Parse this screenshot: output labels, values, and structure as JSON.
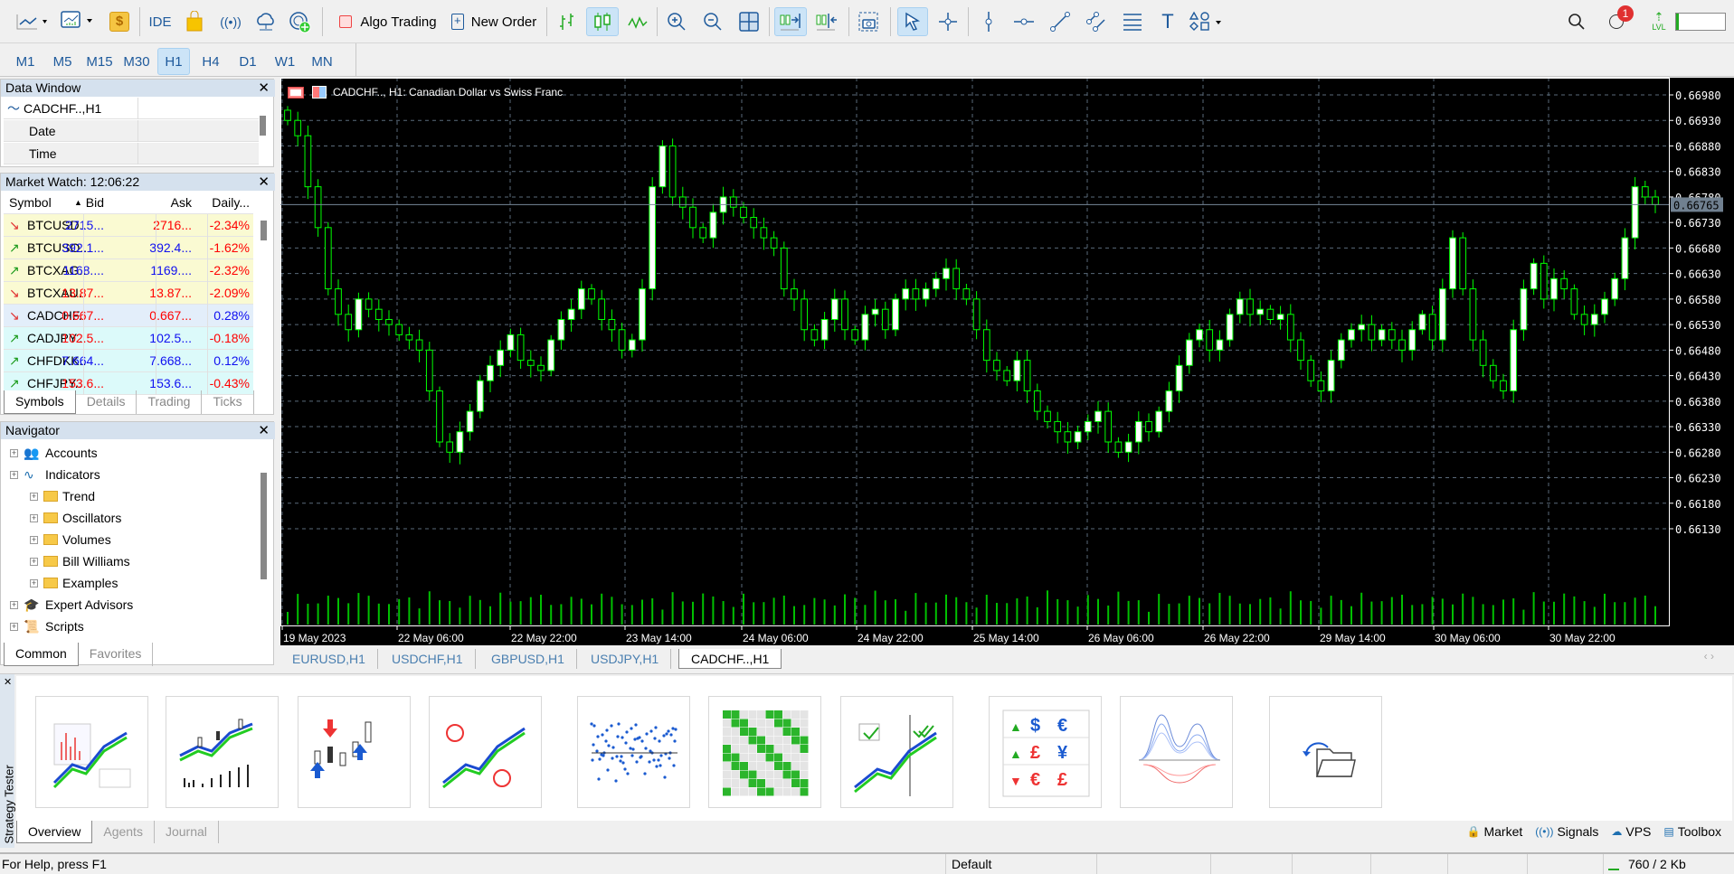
{
  "toolbar": {
    "ide": "IDE",
    "algo_trading": "Algo Trading",
    "new_order": "New Order",
    "notification_count": "1",
    "level_label": "LVL"
  },
  "timeframes": [
    {
      "label": "M1"
    },
    {
      "label": "M5"
    },
    {
      "label": "M15"
    },
    {
      "label": "M30"
    },
    {
      "label": "H1",
      "active": true
    },
    {
      "label": "H4"
    },
    {
      "label": "D1"
    },
    {
      "label": "W1"
    },
    {
      "label": "MN"
    }
  ],
  "data_window": {
    "title": "Data Window",
    "symbol": "CADCHF..,H1",
    "rows": [
      {
        "label": "Date"
      },
      {
        "label": "Time"
      }
    ]
  },
  "market_watch": {
    "title": "Market Watch: 12:06:22",
    "columns": [
      "Symbol",
      "Bid",
      "Ask",
      "Daily..."
    ],
    "rows": [
      {
        "dir": "down",
        "symbol": "BTCUSD..",
        "bid": "2715...",
        "ask": "2716...",
        "daily": "-2.34%",
        "bid_c": "blue",
        "ask_c": "red",
        "daily_c": "red",
        "bg": "#fafad2"
      },
      {
        "dir": "up",
        "symbol": "BTCUSO..",
        "bid": "392.1...",
        "ask": "392.4...",
        "daily": "-1.62%",
        "bid_c": "blue",
        "ask_c": "blue",
        "daily_c": "red",
        "bg": "#fafad2"
      },
      {
        "dir": "up",
        "symbol": "BTCXAG..",
        "bid": "1168....",
        "ask": "1169....",
        "daily": "-2.32%",
        "bid_c": "blue",
        "ask_c": "blue",
        "daily_c": "red",
        "bg": "#fafad2"
      },
      {
        "dir": "down",
        "symbol": "BTCXAU..",
        "bid": "13.87...",
        "ask": "13.87...",
        "daily": "-2.09%",
        "bid_c": "red",
        "ask_c": "red",
        "daily_c": "red",
        "bg": "#fafad2"
      },
      {
        "dir": "down",
        "symbol": "CADCHF..",
        "bid": "0.667...",
        "ask": "0.667...",
        "daily": "0.28%",
        "bid_c": "red",
        "ask_c": "red",
        "daily_c": "blue",
        "bg": "#e3eefa"
      },
      {
        "dir": "up",
        "symbol": "CADJPY..",
        "bid": "102.5...",
        "ask": "102.5...",
        "daily": "-0.18%",
        "bid_c": "red",
        "ask_c": "blue",
        "daily_c": "red",
        "bg": "#dcfafa"
      },
      {
        "dir": "up",
        "symbol": "CHFDKK..",
        "bid": "7.664...",
        "ask": "7.668...",
        "daily": "0.12%",
        "bid_c": "blue",
        "ask_c": "blue",
        "daily_c": "blue",
        "bg": "#dcfafa"
      },
      {
        "dir": "up",
        "symbol": "CHFJPY..",
        "bid": "153.6...",
        "ask": "153.6...",
        "daily": "-0.43%",
        "bid_c": "red",
        "ask_c": "blue",
        "daily_c": "red",
        "bg": "#dcfafa"
      }
    ],
    "tabs": [
      "Symbols",
      "Details",
      "Trading",
      "Ticks"
    ]
  },
  "navigator": {
    "title": "Navigator",
    "items": [
      {
        "label": "Accounts",
        "level": 0,
        "icon": "accounts"
      },
      {
        "label": "Indicators",
        "level": 0,
        "icon": "indicators"
      },
      {
        "label": "Trend",
        "level": 1,
        "icon": "folder"
      },
      {
        "label": "Oscillators",
        "level": 1,
        "icon": "folder"
      },
      {
        "label": "Volumes",
        "level": 1,
        "icon": "folder"
      },
      {
        "label": "Bill Williams",
        "level": 1,
        "icon": "folder"
      },
      {
        "label": "Examples",
        "level": 1,
        "icon": "folder"
      },
      {
        "label": "Expert Advisors",
        "level": 0,
        "icon": "expert"
      },
      {
        "label": "Scripts",
        "level": 0,
        "icon": "scripts"
      }
    ],
    "tabs": [
      "Common",
      "Favorites"
    ]
  },
  "chart": {
    "title": "CADCHF.., H1:  Canadian Dollar vs Swiss Franc",
    "tabs": [
      "EURUSD,H1",
      "USDCHF,H1",
      "GBPUSD,H1",
      "USDJPY,H1",
      "CADCHF..,H1"
    ],
    "active_tab": 4,
    "current_price_label": "0.66765"
  },
  "chart_data": {
    "type": "candlestick",
    "symbol": "CADCHF",
    "timeframe": "H1",
    "y_ticks": [
      "0.66980",
      "0.66930",
      "0.66880",
      "0.66830",
      "0.66780",
      "0.66730",
      "0.66680",
      "0.66630",
      "0.66580",
      "0.66530",
      "0.66480",
      "0.66430",
      "0.66380",
      "0.66330",
      "0.66280",
      "0.66230",
      "0.66180",
      "0.66130"
    ],
    "x_ticks": [
      "19 May 2023",
      "22 May 06:00",
      "22 May 22:00",
      "23 May 14:00",
      "24 May 06:00",
      "24 May 22:00",
      "25 May 14:00",
      "26 May 06:00",
      "26 May 22:00",
      "29 May 14:00",
      "30 May 06:00",
      "30 May 22:00"
    ],
    "ylim": [
      0.6611,
      0.67
    ],
    "current_price": 0.66765,
    "grid": true,
    "closes": [
      0.6693,
      0.669,
      0.668,
      0.6672,
      0.666,
      0.6655,
      0.6652,
      0.6658,
      0.6656,
      0.6654,
      0.6653,
      0.6651,
      0.665,
      0.6648,
      0.664,
      0.663,
      0.6628,
      0.6632,
      0.6636,
      0.6642,
      0.6645,
      0.6648,
      0.6651,
      0.6646,
      0.6645,
      0.6644,
      0.665,
      0.6654,
      0.6656,
      0.666,
      0.6658,
      0.6654,
      0.6652,
      0.6648,
      0.665,
      0.666,
      0.668,
      0.6688,
      0.6678,
      0.6676,
      0.6672,
      0.667,
      0.6675,
      0.6678,
      0.6676,
      0.6674,
      0.6672,
      0.667,
      0.6668,
      0.666,
      0.6658,
      0.6652,
      0.665,
      0.6654,
      0.6658,
      0.6652,
      0.665,
      0.6655,
      0.6656,
      0.6652,
      0.6658,
      0.666,
      0.6658,
      0.666,
      0.6662,
      0.6664,
      0.666,
      0.6658,
      0.6652,
      0.6646,
      0.6644,
      0.6642,
      0.6646,
      0.664,
      0.6636,
      0.6634,
      0.6632,
      0.663,
      0.6632,
      0.6634,
      0.6636,
      0.663,
      0.6628,
      0.663,
      0.6634,
      0.6632,
      0.6636,
      0.664,
      0.6645,
      0.665,
      0.6652,
      0.6648,
      0.665,
      0.6655,
      0.6658,
      0.6655,
      0.6656,
      0.6654,
      0.6655,
      0.665,
      0.6646,
      0.6642,
      0.664,
      0.6646,
      0.665,
      0.6652,
      0.6653,
      0.665,
      0.6652,
      0.665,
      0.6648,
      0.6652,
      0.6655,
      0.665,
      0.666,
      0.667,
      0.666,
      0.665,
      0.6645,
      0.6642,
      0.664,
      0.6652,
      0.666,
      0.6665,
      0.6658,
      0.6662,
      0.666,
      0.6655,
      0.6653,
      0.6655,
      0.6658,
      0.6662,
      0.667,
      0.668,
      0.6678,
      0.66765
    ]
  },
  "strategy_tester": {
    "side_label": "Strategy Tester",
    "tabs": [
      "Overview",
      "Agents",
      "Journal"
    ],
    "right_links": [
      "Market",
      "Signals",
      "VPS",
      "Toolbox"
    ]
  },
  "status": {
    "help": "For Help, press F1",
    "profile": "Default",
    "traffic": "760 / 2 Kb"
  },
  "colors": {
    "bull": "#00ff00",
    "chart_bg": "#000000",
    "grid": "#5a6a7a",
    "accent": "#1e5a9c"
  }
}
